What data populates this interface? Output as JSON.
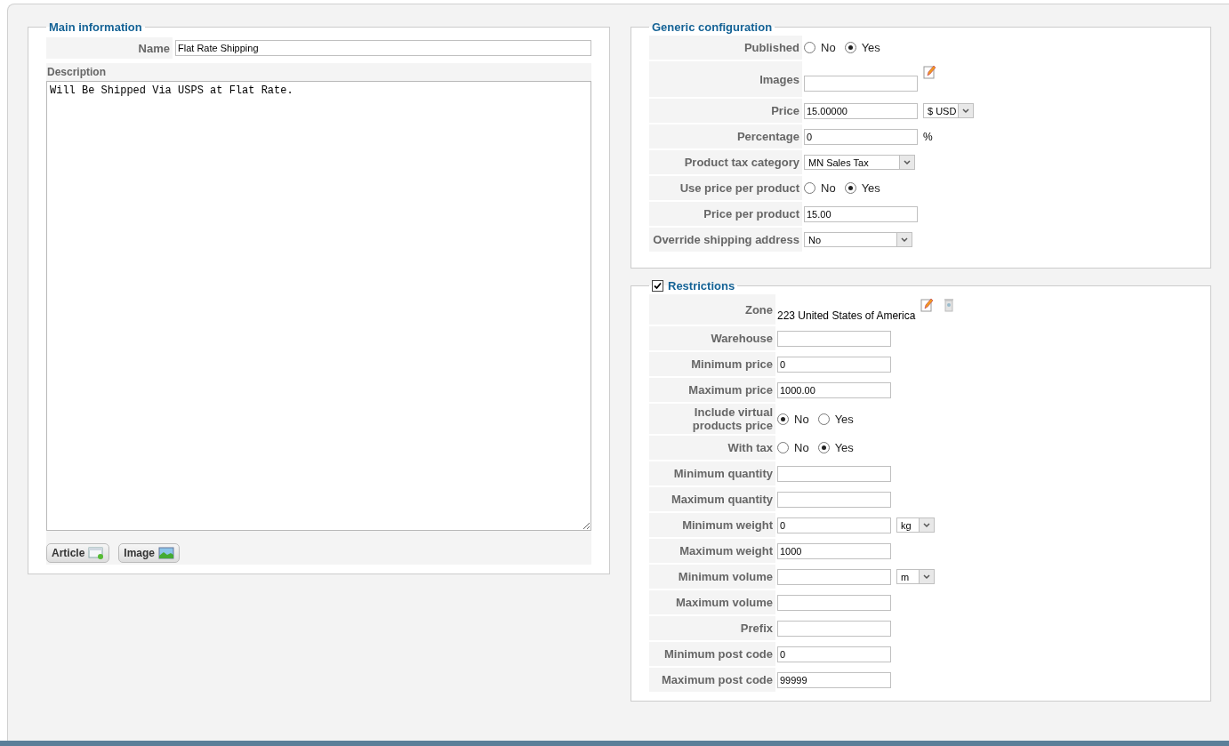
{
  "main_information": {
    "legend": "Main information",
    "name_label": "Name",
    "name_value": "Flat Rate Shipping",
    "description_label": "Description",
    "description_value": "Will Be Shipped Via USPS at Flat Rate.",
    "buttons": [
      {
        "label": "Article",
        "kind": "article"
      },
      {
        "label": "Image",
        "kind": "image"
      }
    ]
  },
  "generic_configuration": {
    "legend": "Generic configuration",
    "rows": [
      {
        "label": "Published",
        "kind": "radio",
        "options": [
          {
            "label": "No",
            "selected": false
          },
          {
            "label": "Yes",
            "selected": true
          }
        ]
      },
      {
        "label": "Images",
        "kind": "image_picker"
      },
      {
        "label": "Price",
        "kind": "text_select",
        "value": "15.00000",
        "select": "$ USD"
      },
      {
        "label": "Percentage",
        "kind": "text",
        "value": "0",
        "suffix": "%"
      },
      {
        "label": "Product tax category",
        "kind": "select",
        "select": "MN Sales Tax"
      },
      {
        "label": "Use price per product",
        "kind": "radio",
        "options": [
          {
            "label": "No",
            "selected": false
          },
          {
            "label": "Yes",
            "selected": true
          }
        ]
      },
      {
        "label": "Price per product",
        "kind": "text",
        "value": "15.00"
      },
      {
        "label": "Override shipping address",
        "kind": "select",
        "select": "No"
      }
    ]
  },
  "restrictions": {
    "legend": "Restrictions",
    "checked": true,
    "rows": [
      {
        "label": "Zone",
        "kind": "zone",
        "value": "223 United States of America"
      },
      {
        "label": "Warehouse",
        "kind": "text"
      },
      {
        "label": "Minimum price",
        "kind": "text",
        "value": "0"
      },
      {
        "label": "Maximum price",
        "kind": "text",
        "value": "1000.00"
      },
      {
        "label": "Include virtual products price",
        "kind": "radio",
        "options": [
          {
            "label": "No",
            "selected": true
          },
          {
            "label": "Yes",
            "selected": false
          }
        ]
      },
      {
        "label": "With tax",
        "kind": "radio",
        "options": [
          {
            "label": "No",
            "selected": false
          },
          {
            "label": "Yes",
            "selected": true
          }
        ]
      },
      {
        "label": "Minimum quantity",
        "kind": "text"
      },
      {
        "label": "Maximum quantity",
        "kind": "text"
      },
      {
        "label": "Minimum weight",
        "kind": "text_select",
        "value": "0",
        "select": "kg"
      },
      {
        "label": "Maximum weight",
        "kind": "text",
        "value": "1000"
      },
      {
        "label": "Minimum volume",
        "kind": "text_select",
        "select": "m"
      },
      {
        "label": "Maximum volume",
        "kind": "text"
      },
      {
        "label": "Prefix",
        "kind": "text"
      },
      {
        "label": "Minimum post code",
        "kind": "text",
        "value": "0"
      },
      {
        "label": "Maximum post code",
        "kind": "text",
        "value": "99999"
      }
    ]
  }
}
